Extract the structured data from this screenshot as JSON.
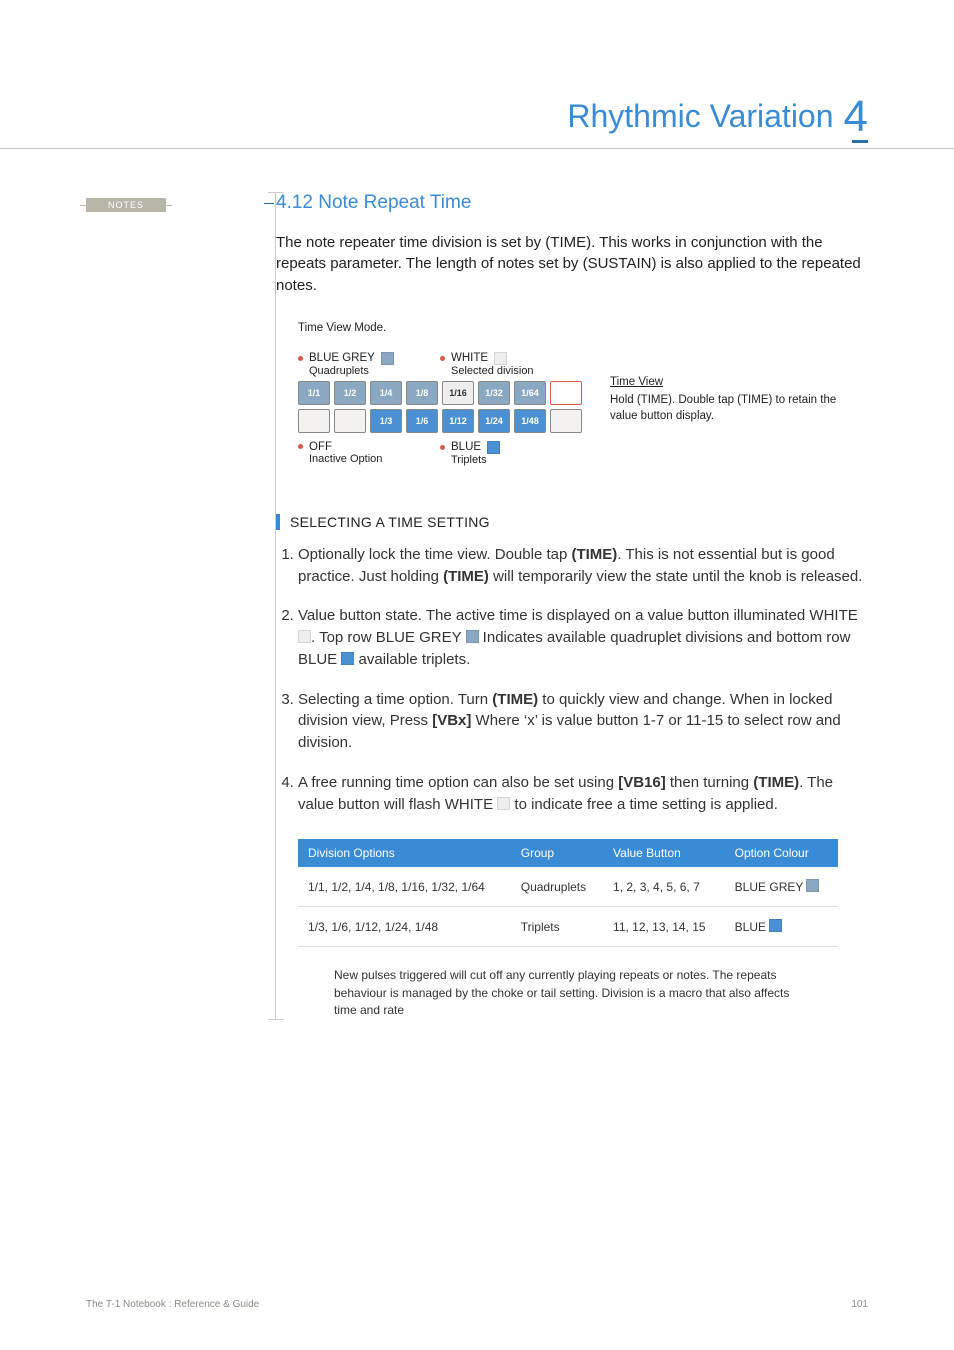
{
  "header": {
    "title": "Rhythmic Variation",
    "chapter_number": "4"
  },
  "sidebar": {
    "notes_label": "NOTES"
  },
  "section": {
    "heading": "4.12 Note Repeat Time",
    "intro": "The note repeater time division is set by (TIME). This works in conjunction with the repeats parameter. The length of notes set by (SUSTAIN) is also applied to the repeated notes."
  },
  "diagram": {
    "title": "Time View Mode.",
    "legend": {
      "top_left": {
        "label": "BLUE GREY",
        "sub": "Quadruplets",
        "swatch": "#8aa8c2"
      },
      "top_right": {
        "label": "WHITE",
        "sub": "Selected division",
        "swatch": "#eeeeee"
      },
      "bottom_left": {
        "label": "OFF",
        "sub": "Inactive Option"
      },
      "bottom_right": {
        "label": "BLUE",
        "sub": "Triplets",
        "swatch": "#4a90d2"
      }
    },
    "row1": [
      "1/1",
      "1/2",
      "1/4",
      "1/8",
      "1/16",
      "1/32",
      "1/64",
      ""
    ],
    "row2": [
      "",
      "",
      "1/3",
      "1/6",
      "1/12",
      "1/24",
      "1/48",
      ""
    ],
    "row1_selected_index": 4,
    "side_note": {
      "title": "Time View",
      "text": "Hold (TIME). Double tap (TIME) to retain the value button display."
    }
  },
  "procedure": {
    "title": "SELECTING A TIME SETTING",
    "steps": [
      {
        "pre": "Optionally lock the time view. Double tap ",
        "b1": "(TIME)",
        "mid": ". This is not essential but is good practice. Just holding ",
        "b2": "(TIME)",
        "post": " will temporarily view the state until the knob is released."
      },
      {
        "text": "Value button state. The active time is displayed on a value button illuminated WHITE ",
        "sw1": "#eeeeee",
        "mid": ". Top row BLUE GREY ",
        "sw2": "#8aa8c2",
        "mid2": " Indicates available quadruplet divisions and bottom row BLUE ",
        "sw3": "#4a90d2",
        "post": " available triplets."
      },
      {
        "pre": "Selecting a time option. Turn ",
        "b1": "(TIME)",
        "mid": " to quickly view and change. When in locked division view, Press ",
        "b2": "[VBx]",
        "post": " Where ‘x’ is value button 1-7 or 11-15 to select row and division."
      },
      {
        "pre": "A free running time option can also be set using ",
        "b1": "[VB16]",
        "mid": " then turning ",
        "b2": "(TIME)",
        "mid2": ". The value button will flash WHITE ",
        "sw": "#eeeeee",
        "post": " to indicate free a time setting is applied."
      }
    ]
  },
  "table": {
    "headers": [
      "Division Options",
      "Group",
      "Value Button",
      "Option Colour"
    ],
    "rows": [
      {
        "c1": "1/1, 1/2, 1/4, 1/8, 1/16, 1/32, 1/64",
        "c2": "Quadruplets",
        "c3": "1, 2, 3, 4, 5, 6, 7",
        "c4": "BLUE GREY",
        "sw": "#8aa8c2"
      },
      {
        "c1": "1/3, 1/6, 1/12, 1/24, 1/48",
        "c2": "Triplets",
        "c3": "11, 12, 13, 14, 15",
        "c4": "BLUE",
        "sw": "#4a90d2"
      }
    ]
  },
  "footnote": "New pulses triggered will cut off any currently playing repeats or notes. The repeats behaviour is managed by the choke or tail setting. Division is a macro that also affects time and rate",
  "footer": {
    "left": "The T-1 Notebook : Reference & Guide",
    "right": "101"
  },
  "chart_data": {
    "type": "table",
    "title": "Note Repeat Time division map",
    "top_row_group": "Quadruplets",
    "bottom_row_group": "Triplets",
    "top_row": [
      "1/1",
      "1/2",
      "1/4",
      "1/8",
      "1/16",
      "1/32",
      "1/64"
    ],
    "bottom_row": [
      "1/3",
      "1/6",
      "1/12",
      "1/24",
      "1/48"
    ],
    "selected": "1/16",
    "colour_legend": {
      "BLUE GREY": "Quadruplets",
      "WHITE": "Selected division",
      "BLUE": "Triplets",
      "OFF": "Inactive Option"
    }
  }
}
